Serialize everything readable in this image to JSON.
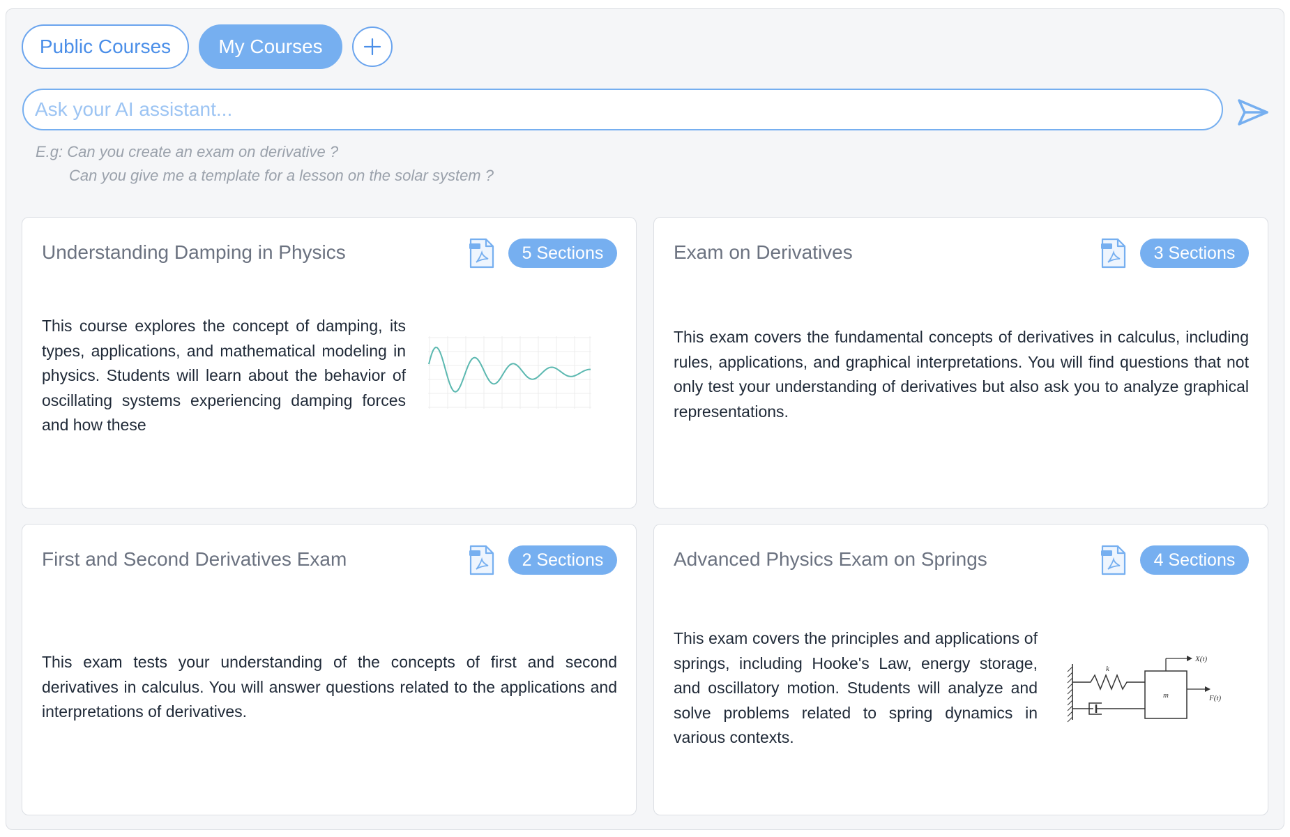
{
  "tabs": {
    "public_label": "Public Courses",
    "my_label": "My Courses",
    "add_icon": "plus-icon"
  },
  "search": {
    "placeholder": "Ask your AI assistant...",
    "send_icon": "send-icon",
    "hint_line1": "E.g: Can you create an exam on derivative ?",
    "hint_line2": "Can you give me a template for a lesson on the solar system ?"
  },
  "colors": {
    "accent": "#76aff0",
    "accent_border": "#6aa4ee",
    "muted_text": "#6b7280",
    "hint_text": "#9aa1ab"
  },
  "cards": [
    {
      "title": "Understanding Damping in Physics",
      "badge": "5 Sections",
      "description": "This course explores the concept of damping, its types, applications, and mathematical modeling in physics. Students will learn about the behavior of oscillating systems experiencing damping forces and how these",
      "icon": "pdf-icon",
      "thumbnail": "damped-oscillation-graph"
    },
    {
      "title": "Exam on Derivatives",
      "badge": "3 Sections",
      "description": "This exam covers the fundamental concepts of derivatives in calculus, including rules, applications, and graphical interpretations. You will find questions that not only test your understanding of derivatives but also ask you to analyze graphical representations.",
      "icon": "pdf-icon"
    },
    {
      "title": "First and Second Derivatives Exam",
      "badge": "2 Sections",
      "description": "This exam tests your understanding of the concepts of first and second derivatives in calculus. You will answer questions related to the applications and interpretations of derivatives.",
      "icon": "pdf-icon"
    },
    {
      "title": "Advanced Physics Exam on Springs",
      "badge": "4 Sections",
      "description": "This exam covers the principles and applications of springs, including Hooke's Law, energy storage, and oscillatory motion. Students will analyze and solve problems related to spring dynamics in various contexts.",
      "icon": "pdf-icon",
      "thumbnail": "spring-mass-damper-diagram",
      "diagram_labels": {
        "x": "X(t)",
        "k": "k",
        "m": "m",
        "f": "F(t)"
      }
    }
  ]
}
